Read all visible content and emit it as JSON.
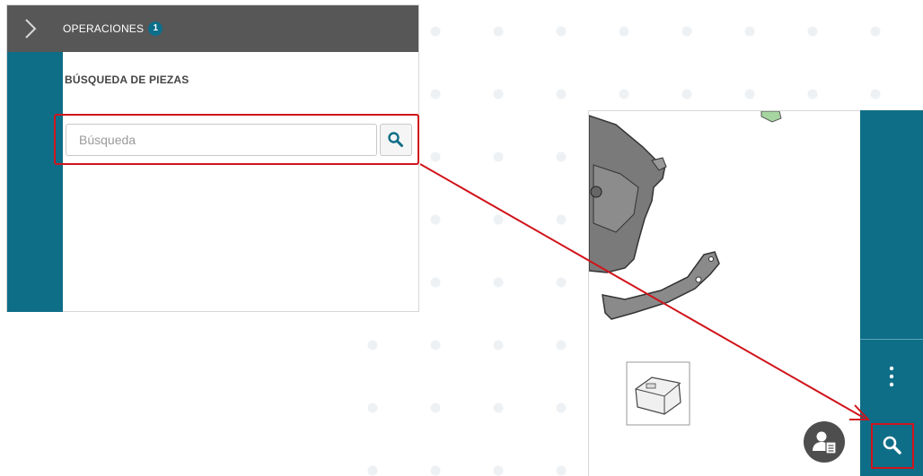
{
  "header": {
    "operations_label": "OPERACIONES",
    "operations_count": "1"
  },
  "panel": {
    "section_title": "BÚSQUEDA DE PIEZAS"
  },
  "search": {
    "placeholder": "Búsqueda",
    "value": ""
  },
  "icons": {
    "expand": "chevron-right-icon",
    "search": "search-icon",
    "more": "more-vertical-icon",
    "user": "user-document-icon"
  },
  "colors": {
    "header_bg": "#575757",
    "accent": "#0f6e87",
    "highlight": "#d0141b",
    "fab": "#4e4e4e"
  }
}
